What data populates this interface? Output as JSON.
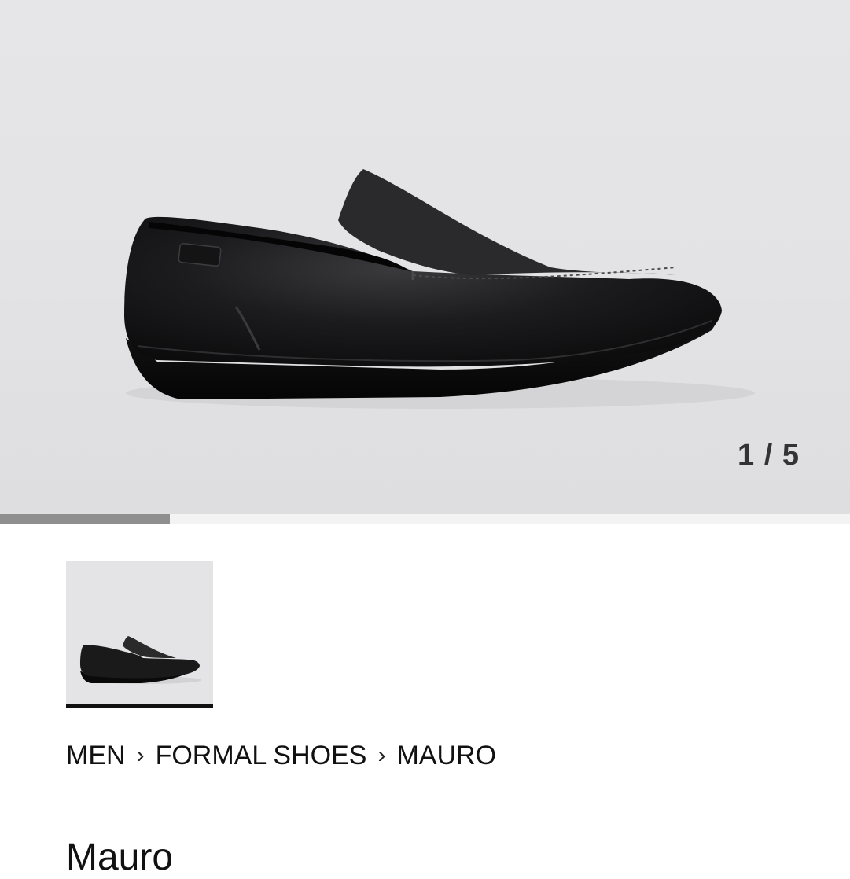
{
  "gallery": {
    "counter": "1 / 5",
    "current": 1,
    "total": 5,
    "progress_fraction": 0.2,
    "main_image": "black-leather-loafer-side-view",
    "thumbnail_image": "black-leather-loafer-thumbnail"
  },
  "breadcrumb": {
    "items": [
      "MEN",
      "FORMAL SHOES",
      "MAURO"
    ],
    "separator_icon": "chevron-right-icon"
  },
  "product": {
    "title": "Mauro"
  },
  "colors": {
    "hero_bg": "#e4e4e6",
    "progress_fill": "#8f8f8f",
    "progress_track": "#f3f3f3",
    "text": "#111111"
  }
}
